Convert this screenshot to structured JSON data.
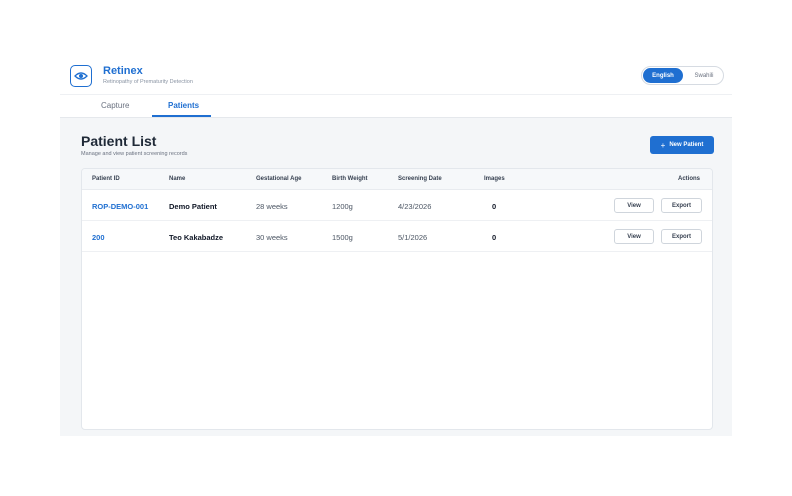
{
  "header": {
    "title": "Retinex",
    "subtitle": "Retinopathy of Prematurity Detection",
    "logo_icon": "eye-icon"
  },
  "language": {
    "options": [
      "English",
      "Swahili"
    ],
    "selected": "English"
  },
  "tabs": [
    {
      "label": "Capture",
      "active": false
    },
    {
      "label": "Patients",
      "active": true
    }
  ],
  "page": {
    "title": "Patient List",
    "subtitle": "Manage and view patient screening records",
    "new_button": "New Patient",
    "new_button_icon": "plus-icon"
  },
  "table": {
    "columns": [
      "Patient ID",
      "Name",
      "Gestational Age",
      "Birth Weight",
      "Screening Date",
      "Images",
      "Actions"
    ],
    "rows": [
      {
        "id": "ROP-DEMO-001",
        "name": "Demo Patient",
        "gestational_age": "28 weeks",
        "birth_weight": "1200g",
        "screening_date": "4/23/2026",
        "images": "0",
        "view": "View",
        "export": "Export"
      },
      {
        "id": "200",
        "name": "Teo Kakabadze",
        "gestational_age": "30 weeks",
        "birth_weight": "1500g",
        "screening_date": "5/1/2026",
        "images": "0",
        "view": "View",
        "export": "Export"
      }
    ]
  },
  "colors": {
    "accent": "#1f6fd1",
    "background": "#f4f6f8"
  }
}
